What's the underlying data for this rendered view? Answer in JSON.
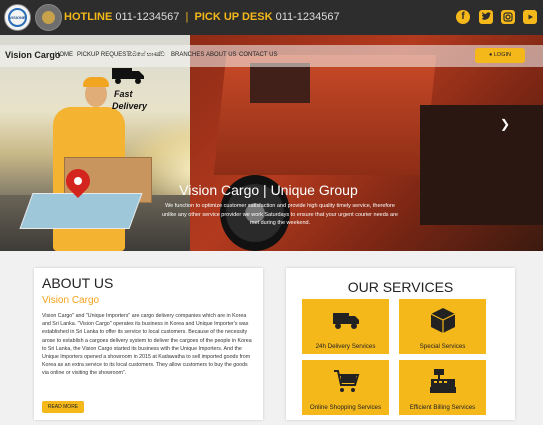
{
  "topbar": {
    "logo_text": "VISIONE",
    "hotline_label": "HOTLINE",
    "hotline_number": "011-1234567",
    "separator": "|",
    "pickup_label": "PICK UP DESK",
    "pickup_number": "011-1234567",
    "social": [
      "facebook-icon",
      "twitter-icon",
      "instagram-icon",
      "youtube-icon"
    ]
  },
  "nav": {
    "brand": "Vision Cargo",
    "items": [
      "HOME",
      "PICKUP REQUEST",
      "ඔබගේ භාණ්ඩ",
      "BRANCHES",
      "ABOUT US",
      "CONTACT US"
    ],
    "login": "LOGIN"
  },
  "hero": {
    "badge_line1": "Fast",
    "badge_line2": "Delivery",
    "title": "Vision Cargo | Unique Group",
    "description": "We function to optimize customer satisfaction and provide high quality timely service, therefore unlike any other service provider we work Saturdays to ensure that your urgent courier needs are met during the weekend."
  },
  "about": {
    "heading": "ABOUT US",
    "subheading": "Vision Cargo",
    "body": "Vision Cargo\" and \"Unique Importers\" are cargo delivery companies which are in Korea and Sri Lanka. \"Vision Cargo\" operates its business in Korea and Unique Importer's was established in Sri Lanka to offer its service to local customers. Because of the necessity arose to establish a cargoes delivery system to deliver the cargoes of the people in Korea to Sri Lanka, the Vision Cargo started its business with the Unique Importers. And the Unique Importers opened a showroom in 2015 at Kadawatha to sell imported goods from Korea as an extra service to its local customers. They allow customers to buy the goods via online or visiting the showroom\".",
    "read_more": "READ MORE"
  },
  "services": {
    "heading": "OUR SERVICES",
    "items": [
      {
        "label": "24h Delivery Services",
        "icon": "truck-icon"
      },
      {
        "label": "Special Services",
        "icon": "package-icon"
      },
      {
        "label": "Online Shopping Services",
        "icon": "cart-icon"
      },
      {
        "label": "Efficient Billing Services",
        "icon": "cash-register-icon"
      }
    ]
  },
  "colors": {
    "accent": "#f4b81b",
    "topbar": "#2d2d2d"
  }
}
